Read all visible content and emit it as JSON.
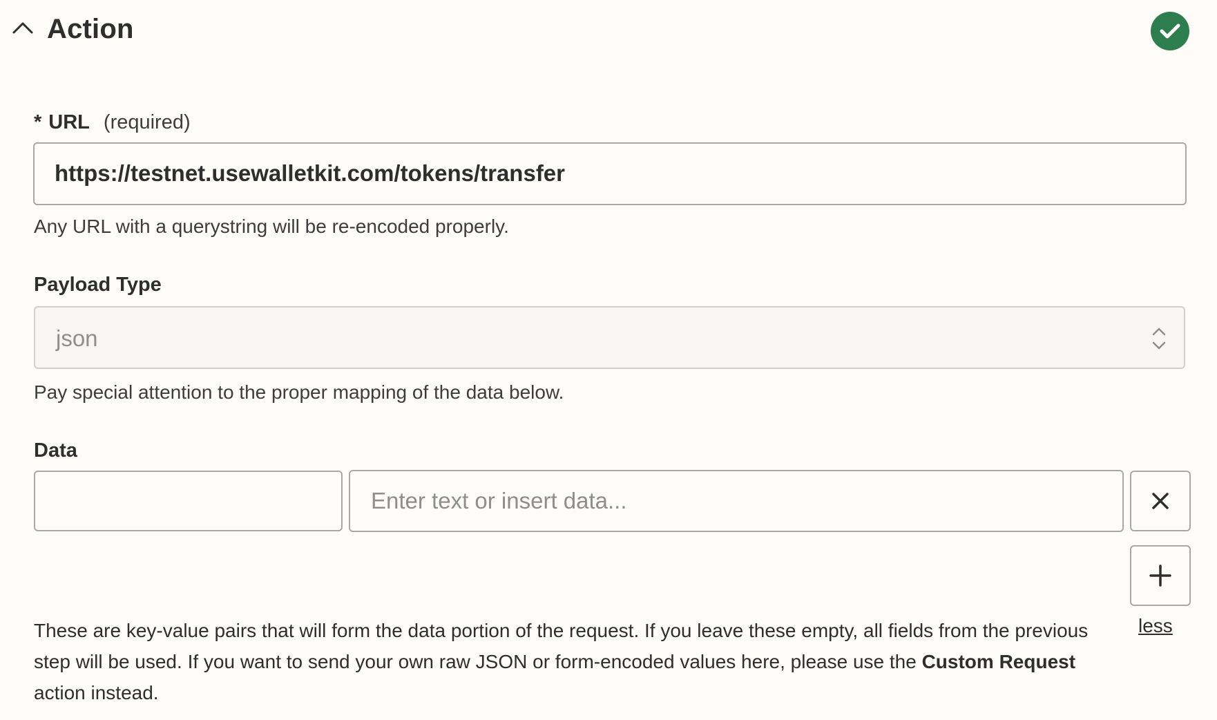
{
  "header": {
    "title": "Action",
    "collapse_icon": "chevron-up-icon",
    "status_icon": "check-circle-icon",
    "status_color": "#2e7d4f"
  },
  "url_field": {
    "required_marker": "*",
    "label": "URL",
    "required_note": "(required)",
    "value": "https://testnet.usewalletkit.com/tokens/transfer",
    "help": "Any URL with a querystring will be re-encoded properly."
  },
  "payload_type": {
    "label": "Payload Type",
    "selected": "json",
    "icon": "chevron-up-down-icon",
    "help": "Pay special attention to the proper mapping of the data below."
  },
  "data_field": {
    "label": "Data",
    "key_value": "",
    "value_placeholder": "Enter text or insert data...",
    "remove_icon": "close-icon",
    "add_icon": "plus-icon",
    "less_label": "less",
    "description_part1": "These are key-value pairs that will form the data portion of the request. If you leave these empty, all fields from the previous step will be used. If you want to send your own raw JSON or form-encoded values here, please use the ",
    "description_bold": "Custom Request",
    "description_part2": " action instead."
  }
}
